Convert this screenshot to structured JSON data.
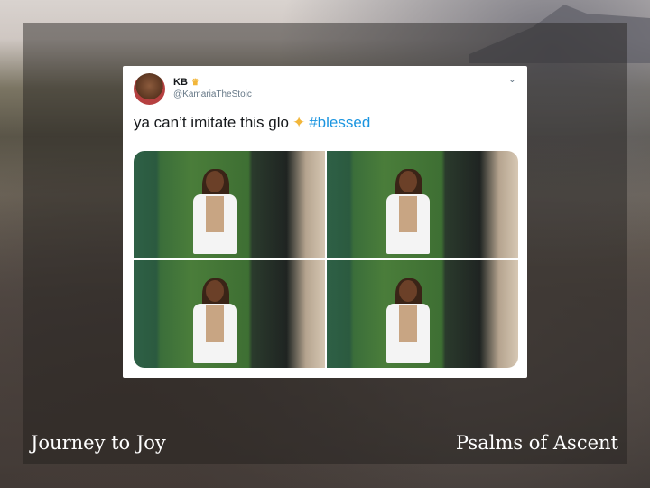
{
  "tweet": {
    "name": "KB",
    "handle": "@KamariaTheStoic",
    "text": "ya can’t imitate this glo",
    "hashtag": "#blessed",
    "chevron": "⌄"
  },
  "icons": {
    "crown": "crown-icon",
    "sparkles": "sparkles-icon"
  },
  "footer": {
    "left": "Journey to Joy",
    "right": "Psalms of Ascent"
  },
  "colors": {
    "hashtag": "#1b95e0",
    "accent": "#f2b63a"
  }
}
